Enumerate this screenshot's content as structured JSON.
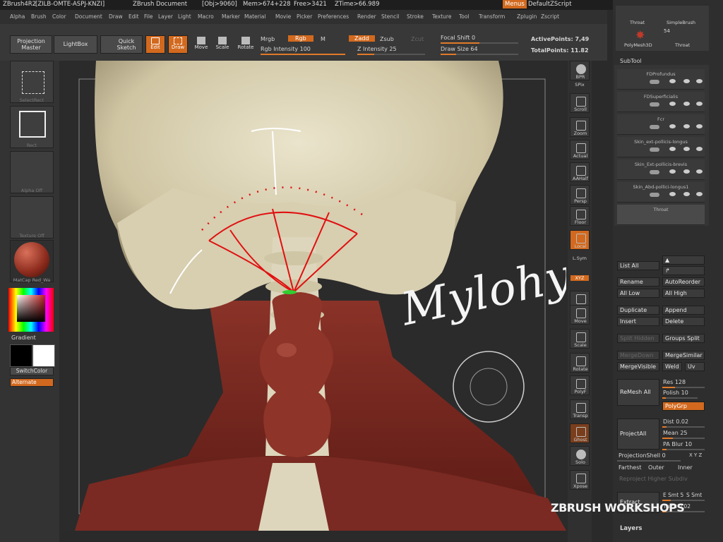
{
  "titlebar": {
    "app": "ZBrush4R2",
    "code": "[ZILB-OMTE-ASPJ-KNZI]",
    "document": "ZBrush Document",
    "obj": "[Obj>9060]",
    "mem": "Mem>674+228",
    "free": "Free>3421",
    "ztime": "ZTime>66.989",
    "menus_label": "Menus",
    "script": "DefaultZScript"
  },
  "menubar": [
    "Alpha",
    "Brush",
    "Color",
    "Document",
    "Draw",
    "Edit",
    "File",
    "Layer",
    "Light",
    "Macro",
    "Marker",
    "Material",
    "Movie",
    "Picker",
    "Preferences",
    "Render",
    "Stencil",
    "Stroke",
    "Texture",
    "Tool",
    "Transform",
    "Zplugin",
    "Zscript"
  ],
  "toolbar": {
    "projection_master": [
      "Projection",
      "Master"
    ],
    "lightbox": "LightBox",
    "quick_sketch": [
      "Quick",
      "Sketch"
    ],
    "edit": "Edit",
    "draw": "Draw",
    "move": "Move",
    "scale": "Scale",
    "rotate": "Rotate",
    "mrgb": "Mrgb",
    "rgb": "Rgb",
    "m": "M",
    "rgb_intensity": "Rgb Intensity 100",
    "zadd": "Zadd",
    "zsub": "Zsub",
    "zcut": "Zcut",
    "z_intensity": "Z Intensity 25",
    "focal_shift": "Focal Shift 0",
    "draw_size": "Draw Size 64",
    "active_points": "ActivePoints: 7,49",
    "total_points": "TotalPoints: 11.82"
  },
  "leftpanel": {
    "select_rect": "SelectRect",
    "rect": "Rect",
    "alpha_off": "Alpha Off",
    "texture_off": "Texture Off",
    "material": "MatCap Red_Wa",
    "gradient": "Gradient",
    "switch_color": "SwitchColor",
    "alternate": "Alternate"
  },
  "righttools": [
    "BPR",
    "SPix",
    "Scroll",
    "Zoom",
    "Actual",
    "AAHalf",
    "Persp",
    "Floor",
    "Local",
    "L.Sym",
    "XYZ",
    "Frame",
    "Move",
    "Scale",
    "Rotate",
    "PolyF",
    "Transp",
    "Ghost",
    "Solo",
    "Xpose"
  ],
  "rightpanel": {
    "top_labels": [
      "Throat",
      "SimpleBrush",
      "PolyMesh3D",
      "Throat"
    ],
    "top_count": "54",
    "subtool_header": "SubTool",
    "subtools": [
      "FDProfundus",
      "FDSuperficialis",
      "Fcr",
      "Skin_ext-pollicis-longus",
      "Skin_Ext-pollicis-brevis",
      "Skin_Abd-pollici-longus1",
      "Throat"
    ],
    "list_all": "List All",
    "rename": "Rename",
    "auto_reorder": "AutoReorder",
    "all_low": "All Low",
    "all_high": "All High",
    "duplicate": "Duplicate",
    "append": "Append",
    "insert": "Insert",
    "delete": "Delete",
    "split_hidden": "Split Hidden",
    "groups_split": "Groups Split",
    "merge_down": "MergeDown",
    "merge_similar": "MergeSimilar",
    "merge_visible": "MergeVisible",
    "weld": "Weld",
    "uv": "Uv",
    "remesh_all": "ReMesh All",
    "res": "Res 128",
    "polish": "Polish 10",
    "polygrp": "PolyGrp",
    "project_all": "ProjectAll",
    "dist": "Dist 0.02",
    "mean": "Mean 25",
    "pa_blur": "PA Blur 10",
    "projection_shell": "ProjectionShell 0",
    "xyz": "X Y Z",
    "farthest": "Farthest",
    "outer": "Outer",
    "inner": "Inner",
    "reproject_higher": "Reproject Higher Subdiv",
    "extract": "Extract",
    "e_smt": "E Smt 5",
    "s_smt": "S Smt",
    "thick": "Thick 0.02",
    "layers": "Layers"
  },
  "viewport": {
    "annotation": "Mylohyoid"
  },
  "watermark": "ZBRUSH WORKSHOPS"
}
